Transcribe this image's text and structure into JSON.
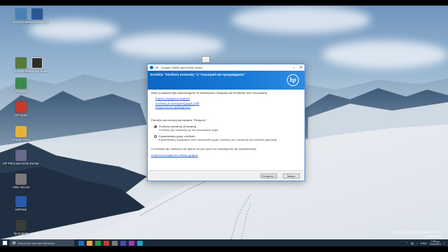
{
  "desktop": {
    "icons": [
      {
        "label": "Recycle Bin",
        "color": "#4a7fb5"
      },
      {
        "label": "Microsoft Word",
        "color": "#2b5797"
      },
      {
        "label": "Photoshop",
        "color": "#5a7a3a"
      },
      {
        "label": "Slideshow Maker",
        "color": "#2e2e2e"
      },
      {
        "label": "Visualizer",
        "color": "#3a8a4a"
      },
      {
        "label": "HP Scan",
        "color": "#c83a2a"
      },
      {
        "label": "Google Drive",
        "color": "#e8b23a"
      },
      {
        "label": "HP Print and Scan Doctor",
        "color": "#6a6a8a"
      },
      {
        "label": "ORC SCAN",
        "color": "#7a7a7a"
      },
      {
        "label": "HPPSdr",
        "color": "#2a5aa8"
      },
      {
        "label": "hp-scanjet",
        "color": "#3a3a3a"
      }
    ],
    "watermark_line1": "Windows 10 Pro Technical Preview",
    "watermark_line2": "Build 10240"
  },
  "dialog": {
    "title": "HP - Scanjet G3000 and G4000 series",
    "banner_title": "Επιλέξτε \"Σύνδεση συσκευής\" ή \"Λογισμικό και προγράμματα\"",
    "logo_text": "hp",
    "intro": "Αυτή η συσκευή έχει εγκατεστημένο το απαιτούμενο λογισμικό και συνδέεται στον υπολογιστή.",
    "links": [
      "Εύρεση λογισμικού σαρωτή",
      "Σύνδεση με υπολογιστή χωρίς USB",
      "Αντιμετώπιση προβλημάτων"
    ],
    "prompt": "Επιλέξτε μία επιλογή και πατήστε \"Επόμενο\".",
    "options": [
      {
        "label": "Σύνδεση συσκευής (Σύσταση)",
        "desc": "Σύνδεση της συσκευής με τον υπολογιστή τώρα.",
        "selected": true
      },
      {
        "label": "Εγκατάσταση χωρίς σύνδεση",
        "desc": "Εγκατάσταση λογισμικού στον υπολογιστή χωρίς σύνδεση της συσκευής και σύνδεση αργότερα.",
        "selected": false
      }
    ],
    "note": "Η σύνδεση της συσκευής θα πρέπει να γίνει μετά την ολοκλήρωση της εγκατάστασης.",
    "agreement_link": "Ανάγνωση συμφωνίας άδειας χρήσης",
    "next_button": "Επόμενο >",
    "cancel_button": "Άκυρο"
  },
  "taskbar": {
    "search_placeholder": "Search the web and Windows",
    "language": "ENG",
    "time": "7:08 μμ",
    "date": "23/8/2015",
    "app_colors": [
      "#1d6fc4",
      "#f0a830",
      "#2e9a40",
      "#c43c2c",
      "#7a7a7a",
      "#4a4ab0",
      "#9a3ab0",
      "#2aa0c0"
    ]
  }
}
